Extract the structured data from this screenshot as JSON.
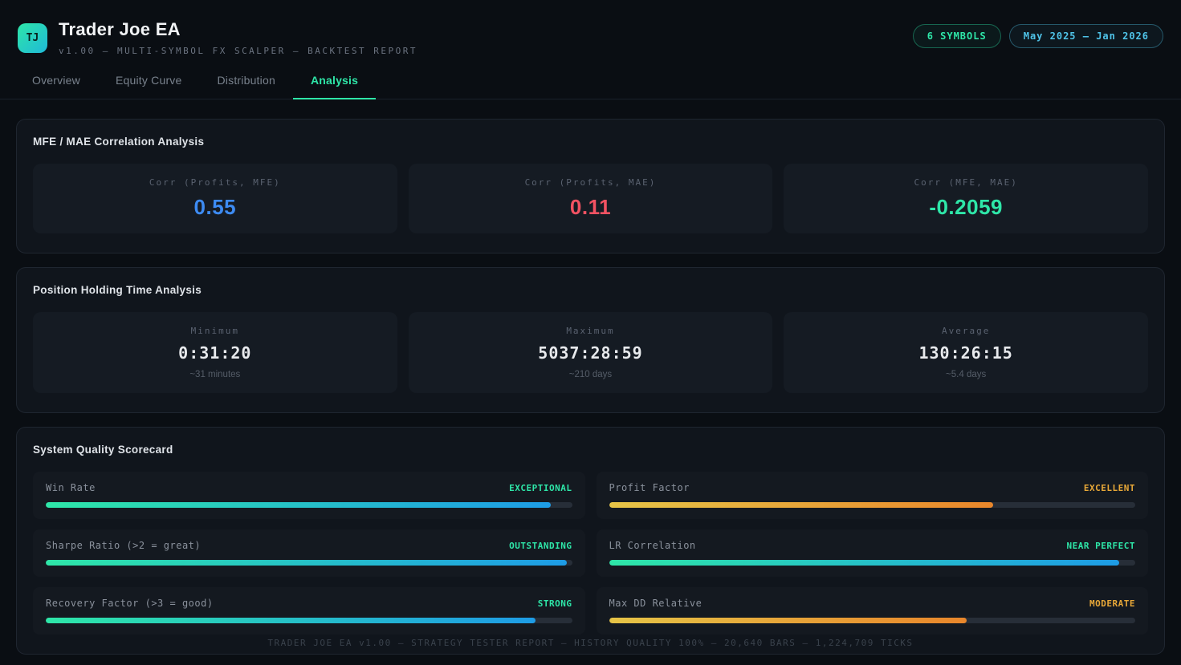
{
  "header": {
    "logo_initials": "TJ",
    "title": "Trader Joe EA",
    "subtitle": "v1.00 — MULTI-SYMBOL FX SCALPER — BACKTEST REPORT",
    "badges": [
      {
        "label": "6 SYMBOLS",
        "color": "#2ee6a8"
      },
      {
        "label": "May 2025 — Jan 2026",
        "color": "#4fc3e8"
      }
    ]
  },
  "tabs": [
    {
      "label": "Overview",
      "active": false
    },
    {
      "label": "Equity Curve",
      "active": false
    },
    {
      "label": "Distribution",
      "active": false
    },
    {
      "label": "Analysis",
      "active": true
    }
  ],
  "correlation_card": {
    "title": "MFE / MAE Correlation Analysis",
    "stats": [
      {
        "label": "Corr (Profits, MFE)",
        "value": "0.55",
        "color": "#3d8bf2"
      },
      {
        "label": "Corr (Profits, MAE)",
        "value": "0.11",
        "color": "#f25262"
      },
      {
        "label": "Corr (MFE, MAE)",
        "value": "-0.2059",
        "color": "#2ee6a8"
      }
    ]
  },
  "holding_time_card": {
    "title": "Position Holding Time Analysis",
    "stats": [
      {
        "label": "Minimum",
        "value": "0:31:20",
        "note": "~31 minutes"
      },
      {
        "label": "Maximum",
        "value": "5037:28:59",
        "note": "~210 days"
      },
      {
        "label": "Average",
        "value": "130:26:15",
        "note": "~5.4 days"
      }
    ]
  },
  "scorecard": {
    "title": "System Quality Scorecard",
    "accent_colors": {
      "teal": "#2ee6a8",
      "amber": "#e8a838"
    },
    "metrics": [
      {
        "label": "Win Rate",
        "rating": "EXCEPTIONAL",
        "pct": 96,
        "theme": "teal"
      },
      {
        "label": "Profit Factor",
        "rating": "EXCELLENT",
        "pct": 73,
        "theme": "amber"
      },
      {
        "label": "Sharpe Ratio (>2 = great)",
        "rating": "OUTSTANDING",
        "pct": 99,
        "theme": "teal"
      },
      {
        "label": "LR Correlation",
        "rating": "NEAR PERFECT",
        "pct": 97,
        "theme": "teal"
      },
      {
        "label": "Recovery Factor (>3 = good)",
        "rating": "STRONG",
        "pct": 93,
        "theme": "teal"
      },
      {
        "label": "Max DD Relative",
        "rating": "MODERATE",
        "pct": 68,
        "theme": "amber"
      }
    ]
  },
  "footer": {
    "text": "TRADER JOE EA v1.00 — STRATEGY TESTER REPORT — HISTORY QUALITY 100% — 20,640 BARS — 1,224,709 TICKS"
  }
}
